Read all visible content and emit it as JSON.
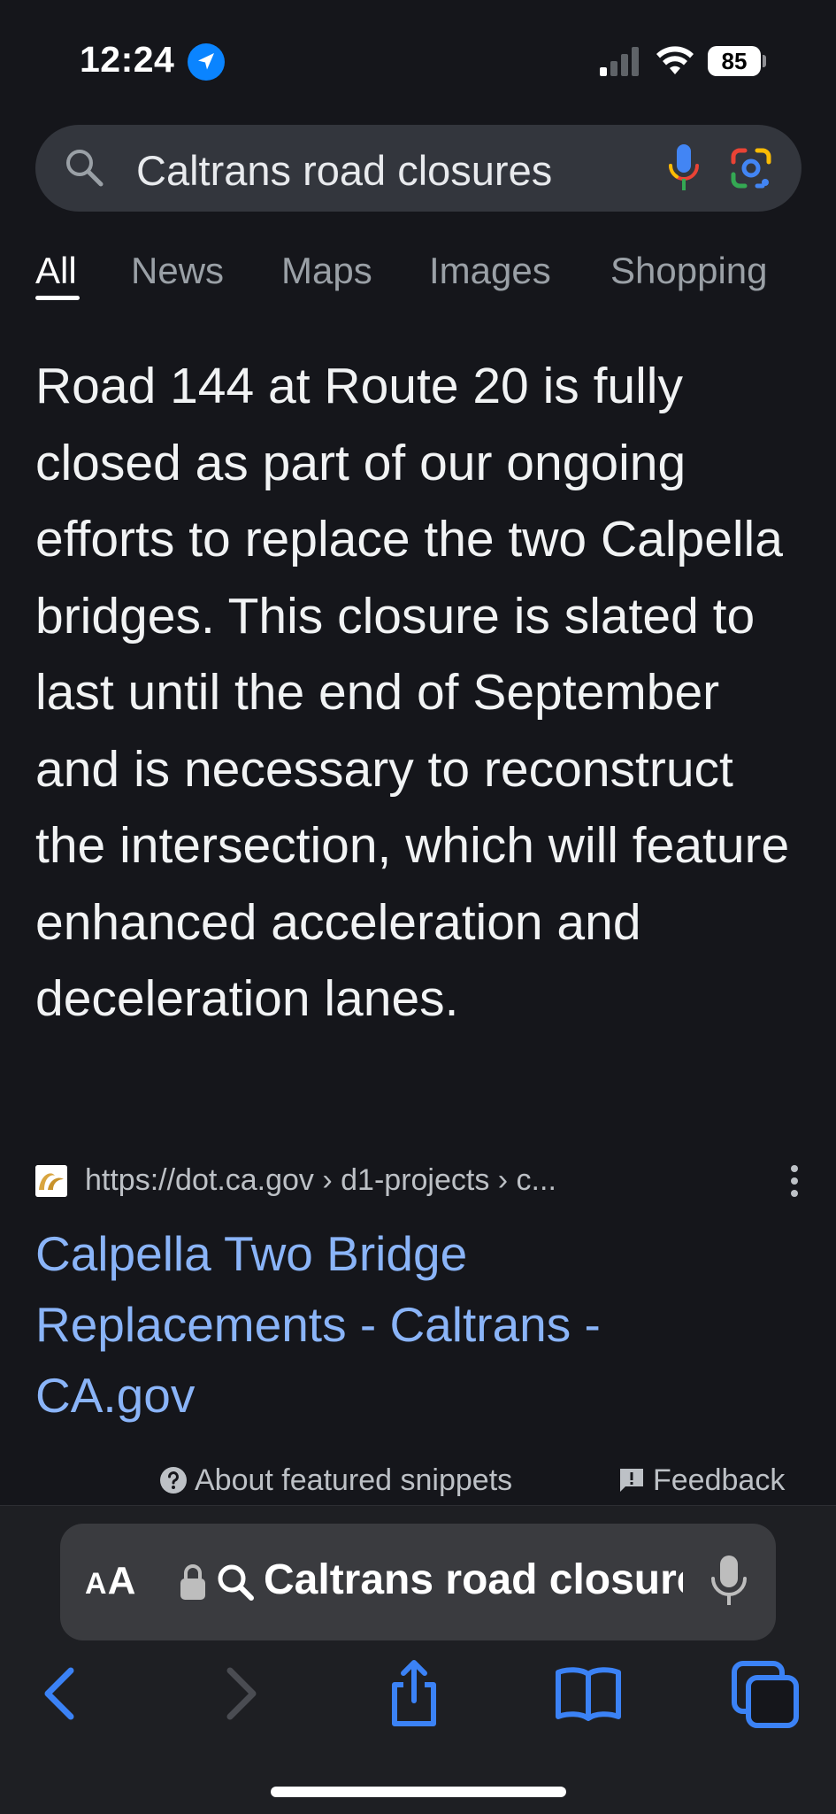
{
  "status_bar": {
    "time": "12:24",
    "battery": "85"
  },
  "search": {
    "query": "Caltrans road closures"
  },
  "tabs": [
    {
      "label": "All",
      "active": true
    },
    {
      "label": "News",
      "active": false
    },
    {
      "label": "Maps",
      "active": false
    },
    {
      "label": "Images",
      "active": false
    },
    {
      "label": "Shopping",
      "active": false
    }
  ],
  "snippet": {
    "text": "Road 144 at Route 20 is fully closed as part of our ongoing efforts to replace the two Calpella bridges. This closure is slated to last until the end of September and is necessary to reconstruct the intersection, which will feature enhanced acceleration and deceleration lanes."
  },
  "result": {
    "url": "https://dot.ca.gov › d1-projects › c...",
    "title": "Calpella Two Bridge Replacements - Caltrans - CA.gov",
    "favicon_text": "CA"
  },
  "footer": {
    "about_label": "About featured snippets",
    "feedback_label": "Feedback"
  },
  "browser": {
    "aa_big": "A",
    "aa_small": "A",
    "address_text": "Caltrans road closures"
  },
  "colors": {
    "background": "#15161b",
    "link": "#8ab4f8",
    "ios_blue": "#3b82f6"
  }
}
